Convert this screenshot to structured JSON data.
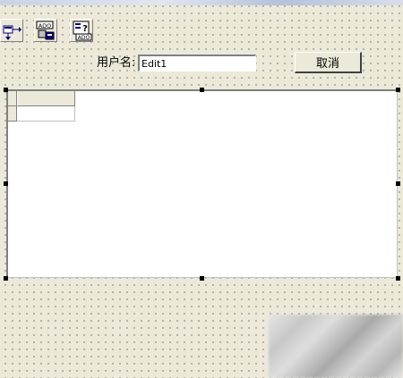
{
  "form": {
    "username_label": "用户名:",
    "username_value": "Edit1",
    "cancel_label": "取消"
  },
  "components": [
    {
      "name": "data-control-icon"
    },
    {
      "name": "ado-connection-icon"
    },
    {
      "name": "ado-query-icon"
    }
  ],
  "icon_text": {
    "ado": "ADO"
  },
  "colors": {
    "form_background": "#ece9d8",
    "grid_background": "#ffffff",
    "handle": "#000000"
  }
}
